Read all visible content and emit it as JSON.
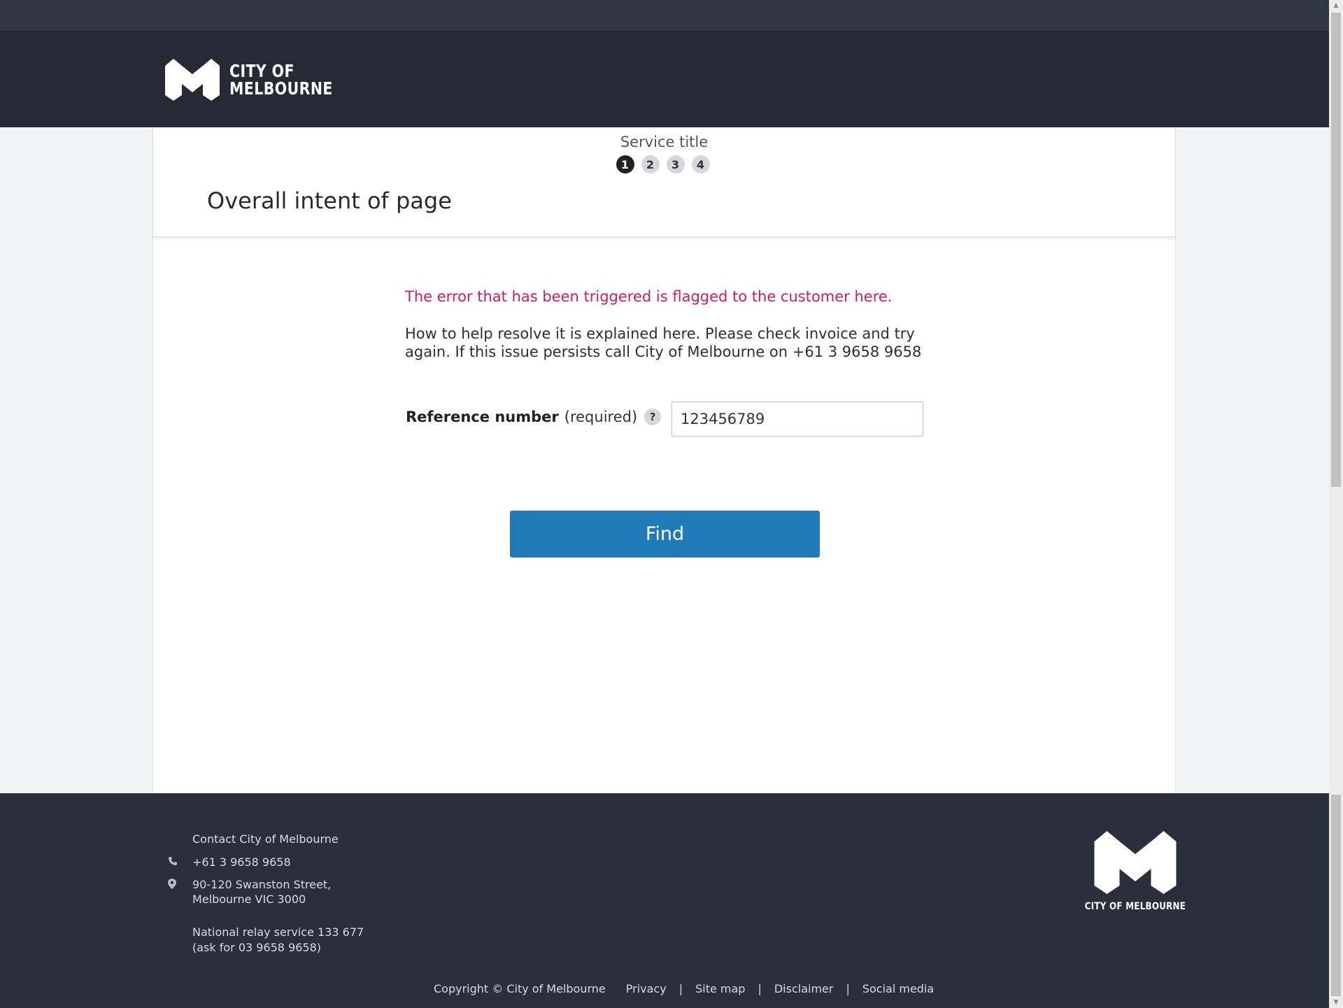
{
  "header": {
    "logo_line1": "CITY OF",
    "logo_line2": "MELBOURNE"
  },
  "form": {
    "service_title": "Service title",
    "steps": [
      "1",
      "2",
      "3",
      "4"
    ],
    "active_step": 1,
    "page_intent": "Overall intent of page",
    "error_message": "The error that has been triggered is flagged to the customer here.",
    "help_line1": "How to help resolve it is explained here. Please check invoice and try",
    "help_line2": "again. If this issue persists call City of Melbourne on +61 3 9658 9658",
    "reference_label": "Reference number",
    "reference_required": "(required)",
    "help_icon": "?",
    "reference_value": "123456789",
    "find_label": "Find"
  },
  "footer": {
    "contact_title": "Contact City of Melbourne",
    "phone": "+61 3 9658 9658",
    "address_line1": "90-120 Swanston Street,",
    "address_line2": "Melbourne VIC 3000",
    "relay_line1": "National relay service 133 677",
    "relay_line2": "(ask for 03 9658 9658)",
    "logo_text": "CITY OF MELBOURNE",
    "copyright": "Copyright © City of Melbourne",
    "links": [
      "Privacy",
      "Site map",
      "Disclaimer",
      "Social media"
    ],
    "separator": "|"
  },
  "icons": {
    "phone": "phone-icon",
    "location": "map-pin-icon"
  },
  "colors": {
    "header_bg": "#272a34",
    "footer_bg": "#2b2f3b",
    "error": "#d31a5c",
    "button": "#1f7ab8"
  }
}
